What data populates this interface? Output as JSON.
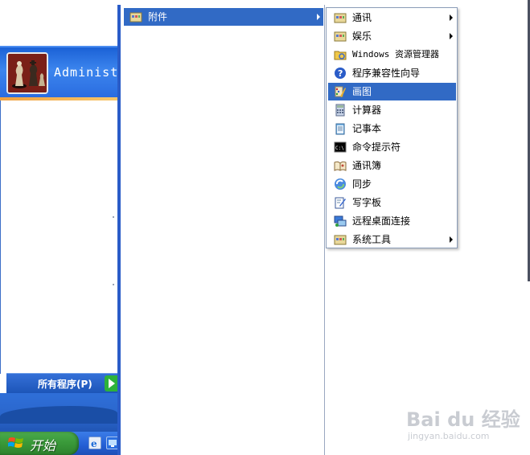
{
  "start_menu": {
    "user_name": "Administ",
    "all_programs_label": "所有程序(P)"
  },
  "taskbar": {
    "start_label": "开始"
  },
  "programs_menu": {
    "accessories_label": "附件"
  },
  "accessories_menu": {
    "items": [
      {
        "label": "通讯",
        "icon": "folder-icon",
        "submenu": true
      },
      {
        "label": "娱乐",
        "icon": "folder-icon",
        "submenu": true
      },
      {
        "label": "Windows 资源管理器",
        "icon": "explorer-icon",
        "submenu": false
      },
      {
        "label": "程序兼容性向导",
        "icon": "help-icon",
        "submenu": false
      },
      {
        "label": "画图",
        "icon": "paint-icon",
        "submenu": false,
        "highlighted": true
      },
      {
        "label": "计算器",
        "icon": "calculator-icon",
        "submenu": false
      },
      {
        "label": "记事本",
        "icon": "notepad-icon",
        "submenu": false
      },
      {
        "label": "命令提示符",
        "icon": "command-prompt-icon",
        "submenu": false
      },
      {
        "label": "通讯簿",
        "icon": "address-book-icon",
        "submenu": false
      },
      {
        "label": "同步",
        "icon": "sync-icon",
        "submenu": false
      },
      {
        "label": "写字板",
        "icon": "wordpad-icon",
        "submenu": false
      },
      {
        "label": "远程桌面连接",
        "icon": "remote-desktop-icon",
        "submenu": false
      },
      {
        "label": "系统工具",
        "icon": "folder-icon",
        "submenu": true
      }
    ]
  },
  "watermark": {
    "brand": "Bai du 经验",
    "url": "jingyan.baidu.com"
  },
  "colors": {
    "highlight": "#316ac5",
    "start_green": "#3a9a3a",
    "xp_blue": "#245ed4"
  }
}
